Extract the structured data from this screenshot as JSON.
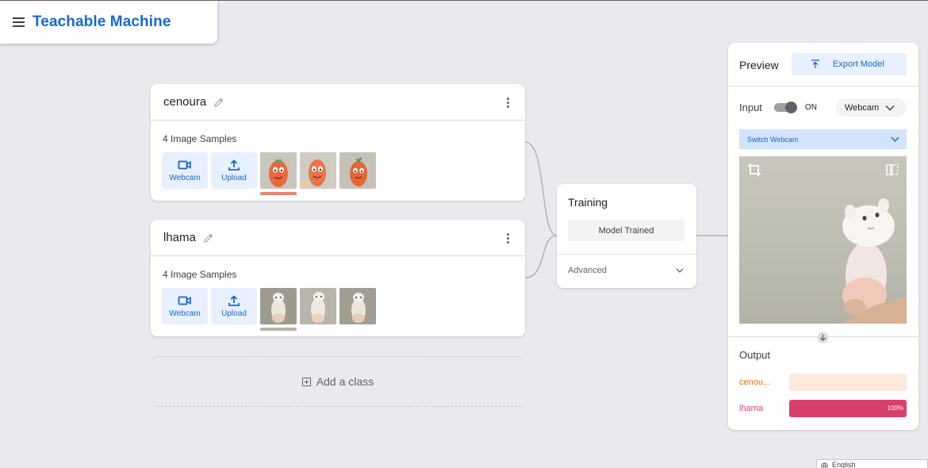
{
  "header": {
    "title": "Teachable Machine"
  },
  "classes": [
    {
      "name": "cenoura",
      "samples_label": "4 Image Samples",
      "webcam_label": "Webcam",
      "upload_label": "Upload",
      "thumbs": [
        "carrot-1",
        "carrot-2",
        "carrot-3"
      ]
    },
    {
      "name": "lhama",
      "samples_label": "4 Image Samples",
      "webcam_label": "Webcam",
      "upload_label": "Upload",
      "thumbs": [
        "llama-1",
        "llama-2",
        "llama-3"
      ]
    }
  ],
  "add_class": {
    "label": "Add a class"
  },
  "training": {
    "title": "Training",
    "button": "Model Trained",
    "advanced": "Advanced"
  },
  "preview": {
    "title": "Preview",
    "export": "Export Model",
    "input_label": "Input",
    "toggle_state": "ON",
    "source": "Webcam",
    "switch_webcam": "Switch Webcam",
    "output_label": "Output",
    "outputs": [
      {
        "name": "cenou...",
        "percent": 0,
        "color": "#e37400",
        "track": "#fce8dc"
      },
      {
        "name": "lhama",
        "percent": 100,
        "percent_label": "100%",
        "color": "#d93f6b",
        "track": "#fbe0e7"
      }
    ]
  },
  "colors": {
    "brand": "#1967d2",
    "background": "#e8eaed"
  },
  "footer": {
    "language": "English"
  }
}
